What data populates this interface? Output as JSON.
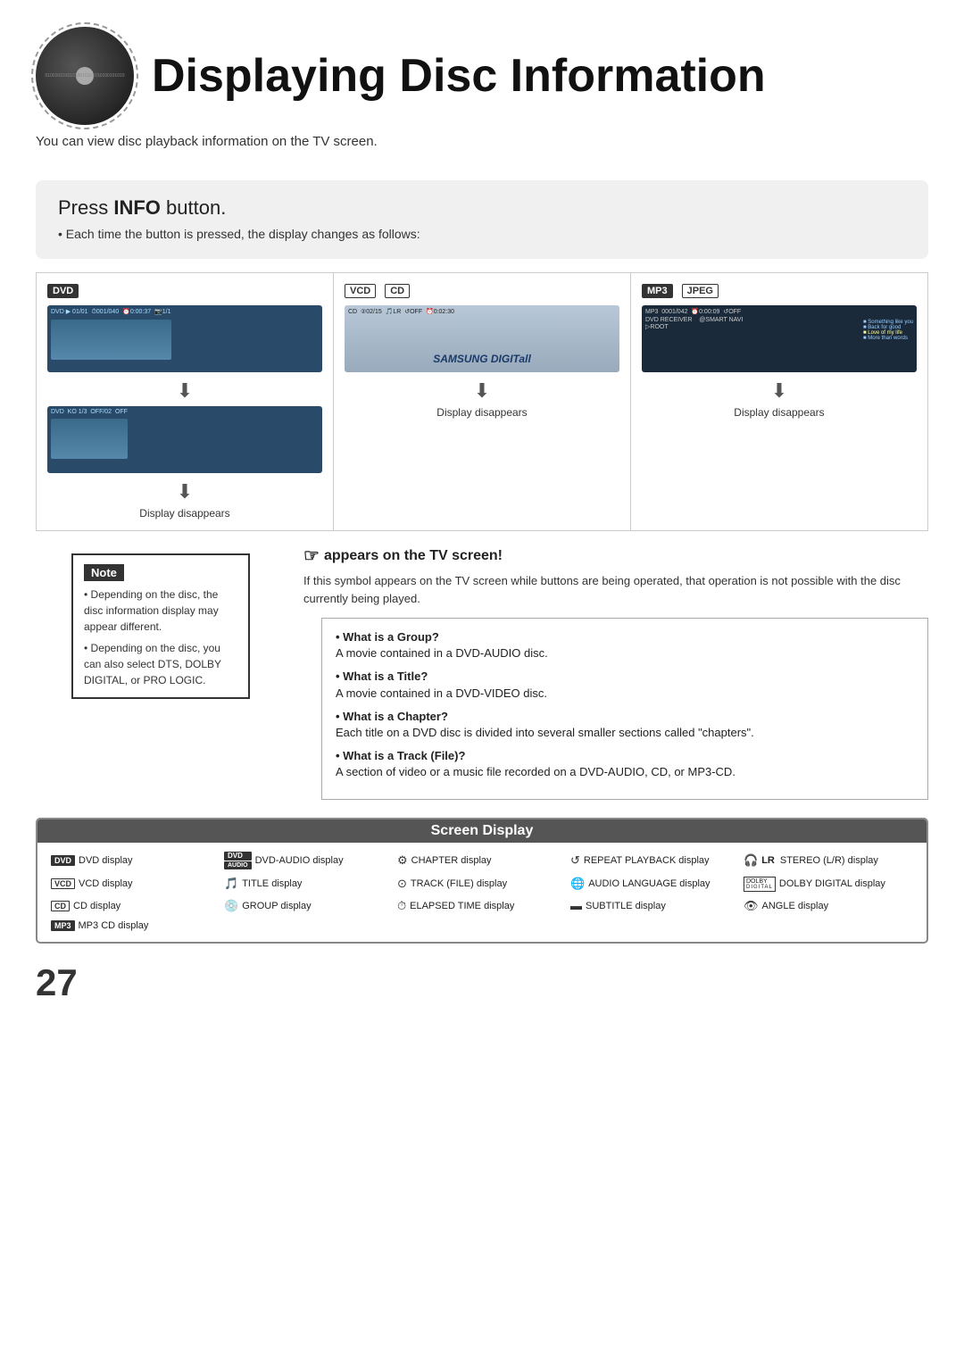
{
  "page": {
    "number": "27",
    "title": "Displaying Disc Information",
    "subtitle": "You can view disc playback information  on the TV screen."
  },
  "info_section": {
    "title": "Press ",
    "title_bold": "INFO",
    "title_suffix": " button.",
    "bullet": "Each time the button is pressed, the display changes as follows:"
  },
  "panels": {
    "dvd": {
      "label": "DVD",
      "screen1_info": "DVD  01/01  001/040  0:00:37  1/1",
      "screen2_info": "DVD  KO 1/3  OFF/ 02  OFF",
      "display_disappears": "Display disappears"
    },
    "vcd_cd": {
      "label1": "VCD",
      "label2": "CD",
      "screen_info": "CD  02/15  LR  OFF  0:02:30",
      "samsung_logo": "SAMSUNG DIGITall",
      "display_disappears": "Display disappears"
    },
    "mp3_jpeg": {
      "label1": "MP3",
      "label2": "JPEG",
      "screen_info": "MP3  0001/042  0:00:09  OFF",
      "left_label": "DVD RECEIVER",
      "right_label": "@ SMART NAVI",
      "root": "ROOT",
      "list": [
        "Something like you",
        "Back for good",
        "Love of my life",
        "More than words"
      ],
      "display_disappears": "Display disappears"
    }
  },
  "tv_appears": {
    "title": " appears on the TV screen!",
    "text": "If this symbol appears on the TV screen while buttons are being operated, that operation is not possible with the disc currently being played."
  },
  "what_is": {
    "items": [
      {
        "label": "What is a Group?",
        "text": "A movie contained in a DVD-AUDIO disc."
      },
      {
        "label": "What is a Title?",
        "text": "A movie contained in a DVD-VIDEO disc."
      },
      {
        "label": "What is a Chapter?",
        "text": "Each title on a DVD disc is divided into several smaller sections called \"chapters\"."
      },
      {
        "label": "What is a Track (File)?",
        "text": "A section of video or a music file recorded on a DVD-AUDIO, CD, or MP3-CD."
      }
    ]
  },
  "note": {
    "header": "Note",
    "items": [
      "Depending on the disc, the disc information display may appear different.",
      "Depending on the disc, you can also select DTS, DOLBY DIGITAL, or PRO LOGIC."
    ]
  },
  "screen_display": {
    "title": "Screen Display",
    "items": [
      {
        "icon": "DVD",
        "icon_type": "badge",
        "label": "DVD display"
      },
      {
        "icon": "DVD AUDIO",
        "icon_type": "badge-double",
        "label": "DVD-AUDIO display"
      },
      {
        "icon": "⚙",
        "icon_type": "symbol",
        "label": "CHAPTER display"
      },
      {
        "icon": "↺",
        "icon_type": "symbol",
        "label": "REPEAT PLAYBACK display"
      },
      {
        "icon": "🎧 LR",
        "icon_type": "symbol",
        "label": "STEREO (L/R) display"
      },
      {
        "icon": "VCD",
        "icon_type": "badge-outline",
        "label": "VCD display"
      },
      {
        "icon": "🎵",
        "icon_type": "symbol",
        "label": "TITLE display"
      },
      {
        "icon": "⊙",
        "icon_type": "symbol",
        "label": "TRACK (FILE) display"
      },
      {
        "icon": "🌐",
        "icon_type": "symbol",
        "label": "AUDIO LANGUAGE display"
      },
      {
        "icon": "DOLBY DIGITAL",
        "icon_type": "badge-special",
        "label": "DOLBY DIGITAL display"
      },
      {
        "icon": "CD",
        "icon_type": "badge-outline",
        "label": "CD display"
      },
      {
        "icon": "💿",
        "icon_type": "symbol",
        "label": "GROUP display"
      },
      {
        "icon": "⏱",
        "icon_type": "symbol",
        "label": "ELAPSED TIME display"
      },
      {
        "icon": "▬▬▬",
        "icon_type": "symbol",
        "label": "SUBTITLE display"
      },
      {
        "icon": "👁",
        "icon_type": "symbol",
        "label": "ANGLE display"
      },
      {
        "icon": "MP3",
        "icon_type": "badge",
        "label": "MP3 CD display"
      }
    ]
  }
}
